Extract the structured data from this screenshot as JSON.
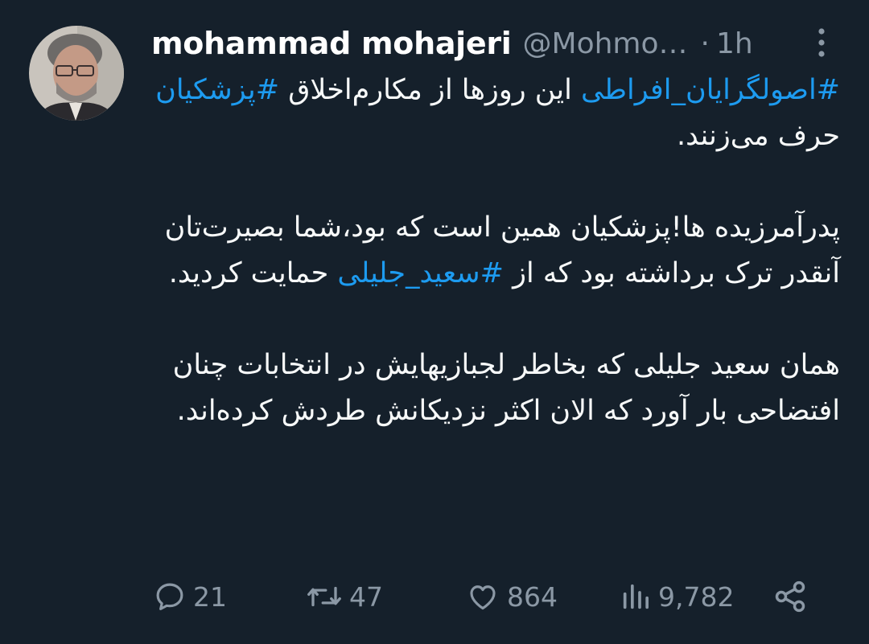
{
  "author": {
    "display_name": "mohammad mohajeri",
    "handle": "@Mohmo…",
    "separator": "·",
    "time": "1h"
  },
  "tweet": {
    "p1": {
      "hashtag1": "#اصولگرایان_افراطی",
      "text1": " این روزها از مکارم‌اخلاق ",
      "hashtag2": "#پزشکیان",
      "text2": " حرف می‌زنند."
    },
    "p2": {
      "text1": "پدرآمرزیده ها!پزشکیان همین است که بود،شما بصیرت‌تان آنقدر ترک برداشته بود که از ",
      "hashtag1": "#سعید_جلیلی",
      "text2": " حمایت کردید."
    },
    "p3": {
      "text1": "همان سعید جلیلی که بخاطر لجبازیهایش در انتخابات چنان افتضاحی بار آورد که الان اکثر نزدیکانش طردش کرده‌اند."
    }
  },
  "actions": {
    "replies": "21",
    "retweets": "47",
    "likes": "864",
    "views": "9,782"
  },
  "colors": {
    "background": "#15202b",
    "accent": "#1d9bf0",
    "muted": "#8b98a5",
    "text": "#f7f9f9"
  },
  "icons": [
    "reply-icon",
    "retweet-icon",
    "like-icon",
    "views-icon",
    "share-icon",
    "more-options-icon"
  ]
}
